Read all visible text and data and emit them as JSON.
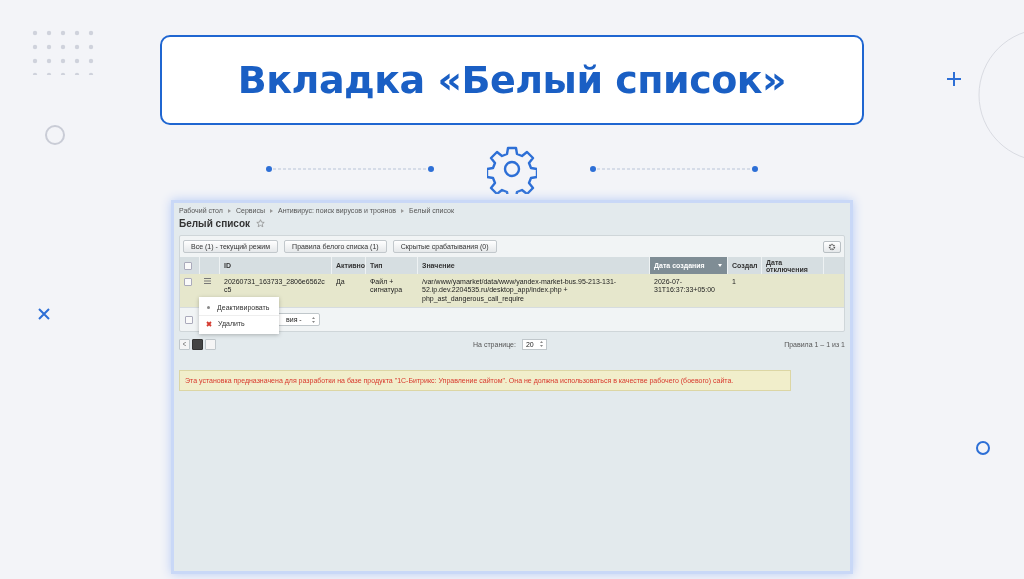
{
  "slide": {
    "title": "Вкладка «Белый список»"
  },
  "screen": {
    "breadcrumbs": [
      "Рабочий стол",
      "Сервисы",
      "Антивирус: поиск вирусов и троянов",
      "Белый список"
    ],
    "page_title": "Белый список",
    "select_all_checked": false,
    "filter_buttons": [
      "Все (1) - текущий режим",
      "Правила белого списка (1)",
      "Скрытые срабатывания (0)"
    ],
    "table": {
      "columns": [
        {
          "label": "ID",
          "sorted": false
        },
        {
          "label": "Активно",
          "sorted": false
        },
        {
          "label": "Тип",
          "sorted": false
        },
        {
          "label": "Значение",
          "sorted": false
        },
        {
          "label": "Дата создания",
          "sorted": true
        },
        {
          "label": "Создал",
          "sorted": false
        },
        {
          "label": "Дата отключения",
          "sorted": false
        }
      ],
      "rows": [
        {
          "checked": false,
          "cells": [
            "20260731_163733_2806e6562cc5",
            "Да",
            "Файл + сигнатура",
            "/var/www/yamarket/data/www/yandex-market-bus.95-213-131-52.ip.dev.2204535.ru/desktop_app/index.php + php_ast_dangerous_call_require",
            "2026-07-31T16:37:33+05:00",
            "1"
          ]
        }
      ]
    },
    "group_action": "вия -",
    "context_menu": [
      {
        "kind": "deactivate",
        "label": "Деактивировать"
      },
      {
        "kind": "delete",
        "label": "Удалить"
      }
    ],
    "per_page_label": "На странице:",
    "per_page": "20",
    "summary": "Правила 1 – 1 из 1",
    "notice": "Эта установка предназначена для разработки на базе продукта \"1С-Битрикс: Управление сайтом\". Она не должна использоваться в качестве рабочего (боевого) сайта."
  }
}
